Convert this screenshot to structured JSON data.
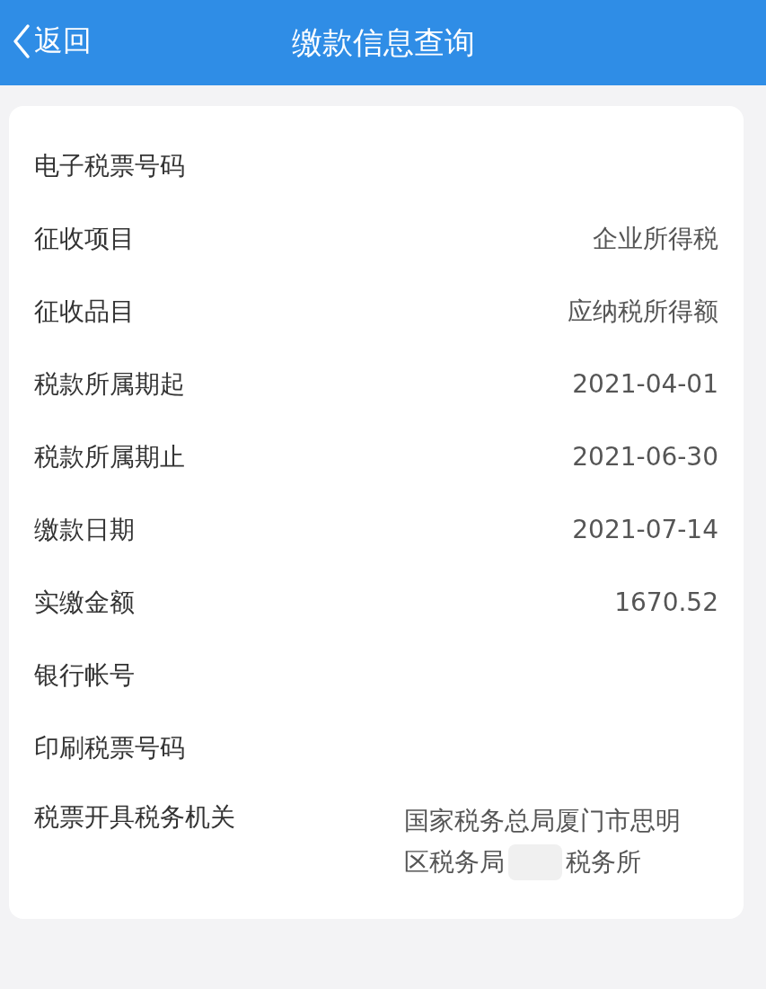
{
  "header": {
    "back": "返回",
    "title": "缴款信息查询"
  },
  "rows": [
    {
      "label": "电子税票号码"
    },
    {
      "label": "征收项目",
      "value": "企业所得税"
    },
    {
      "label": "征收品目",
      "value": "应纳税所得额"
    },
    {
      "label": "税款所属期起",
      "value": "2021-04-01"
    },
    {
      "label": "税款所属期止",
      "value": "2021-06-30"
    },
    {
      "label": "缴款日期",
      "value": "2021-07-14"
    },
    {
      "label": "实缴金额",
      "value": "1670.52"
    },
    {
      "label": "银行帐号"
    },
    {
      "label": "印刷税票号码"
    },
    {
      "label": "税票开具税务机关",
      "value_lines": [
        [
          "国家税务总局厦门市思明"
        ],
        [
          "区税务局",
          "税务所"
        ]
      ]
    }
  ]
}
